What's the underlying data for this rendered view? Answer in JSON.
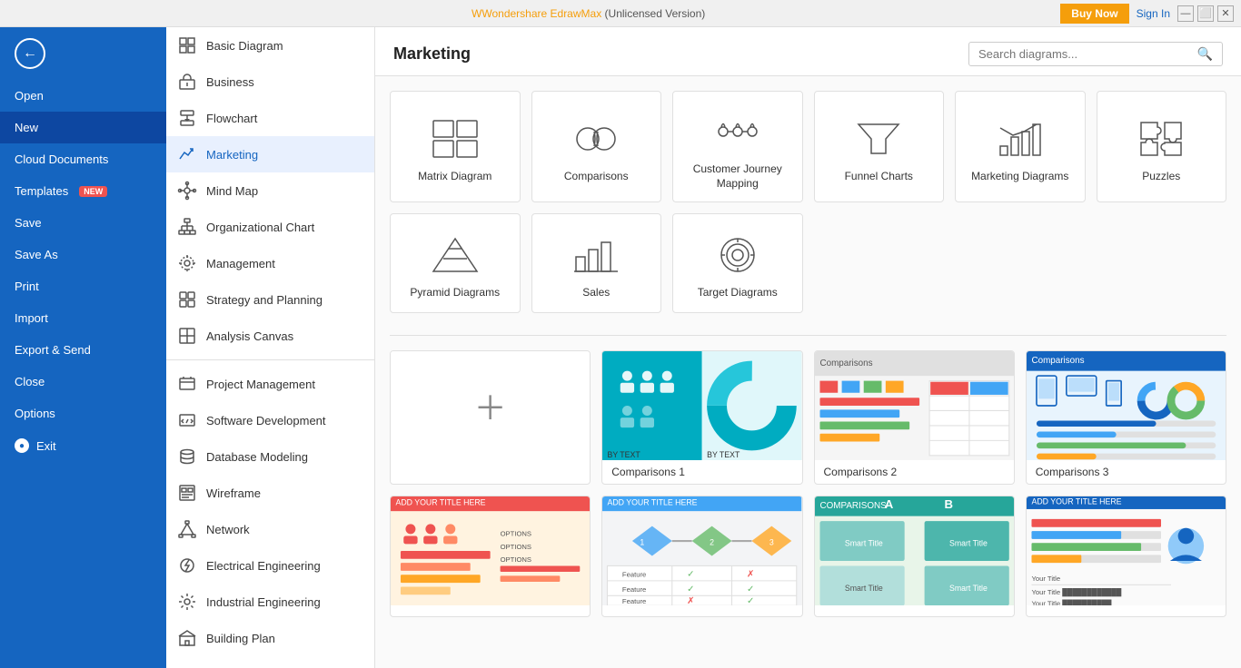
{
  "titlebar": {
    "title": "Wondershare EdrawMax",
    "subtitle": " (Unlicensed Version)",
    "buy_now": "Buy Now",
    "sign_in": "Sign In"
  },
  "sidebar": {
    "items": [
      {
        "id": "open",
        "label": "Open"
      },
      {
        "id": "new",
        "label": "New",
        "active": true
      },
      {
        "id": "cloud",
        "label": "Cloud Documents"
      },
      {
        "id": "templates",
        "label": "Templates",
        "badge": "NEW"
      },
      {
        "id": "save",
        "label": "Save"
      },
      {
        "id": "saveas",
        "label": "Save As"
      },
      {
        "id": "print",
        "label": "Print"
      },
      {
        "id": "import",
        "label": "Import"
      },
      {
        "id": "export",
        "label": "Export & Send"
      },
      {
        "id": "close",
        "label": "Close"
      },
      {
        "id": "options",
        "label": "Options"
      },
      {
        "id": "exit",
        "label": "Exit"
      }
    ]
  },
  "categories": {
    "items": [
      {
        "id": "basic",
        "label": "Basic Diagram"
      },
      {
        "id": "business",
        "label": "Business"
      },
      {
        "id": "flowchart",
        "label": "Flowchart"
      },
      {
        "id": "marketing",
        "label": "Marketing",
        "active": true
      },
      {
        "id": "mindmap",
        "label": "Mind Map"
      },
      {
        "id": "orgchart",
        "label": "Organizational Chart"
      },
      {
        "id": "management",
        "label": "Management"
      },
      {
        "id": "strategy",
        "label": "Strategy and Planning"
      },
      {
        "id": "analysis",
        "label": "Analysis Canvas"
      },
      {
        "id": "project",
        "label": "Project Management"
      },
      {
        "id": "software",
        "label": "Software Development"
      },
      {
        "id": "database",
        "label": "Database Modeling"
      },
      {
        "id": "wireframe",
        "label": "Wireframe"
      },
      {
        "id": "network",
        "label": "Network"
      },
      {
        "id": "electrical",
        "label": "Electrical Engineering"
      },
      {
        "id": "industrial",
        "label": "Industrial Engineering"
      },
      {
        "id": "building",
        "label": "Building Plan"
      }
    ]
  },
  "main": {
    "title": "Marketing",
    "search_placeholder": "Search diagrams...",
    "template_types": [
      {
        "id": "matrix",
        "label": "Matrix Diagram"
      },
      {
        "id": "comparisons",
        "label": "Comparisons"
      },
      {
        "id": "customer_journey",
        "label": "Customer Journey Mapping"
      },
      {
        "id": "funnel",
        "label": "Funnel Charts"
      },
      {
        "id": "marketing_diagrams",
        "label": "Marketing Diagrams"
      },
      {
        "id": "puzzles",
        "label": "Puzzles"
      },
      {
        "id": "pyramid",
        "label": "Pyramid Diagrams"
      },
      {
        "id": "sales",
        "label": "Sales"
      },
      {
        "id": "target",
        "label": "Target Diagrams"
      }
    ],
    "thumbnails": [
      {
        "id": "new-blank",
        "label": "",
        "type": "new"
      },
      {
        "id": "comp1",
        "label": "Comparisons 1",
        "type": "comp1"
      },
      {
        "id": "comp2",
        "label": "Comparisons 2",
        "type": "comp2"
      },
      {
        "id": "comp3",
        "label": "Comparisons 3",
        "type": "comp3"
      },
      {
        "id": "comp4",
        "label": "",
        "type": "comp4"
      },
      {
        "id": "comp5",
        "label": "",
        "type": "comp5"
      },
      {
        "id": "comp6",
        "label": "",
        "type": "comp6"
      },
      {
        "id": "comp7",
        "label": "",
        "type": "comp7"
      }
    ]
  }
}
